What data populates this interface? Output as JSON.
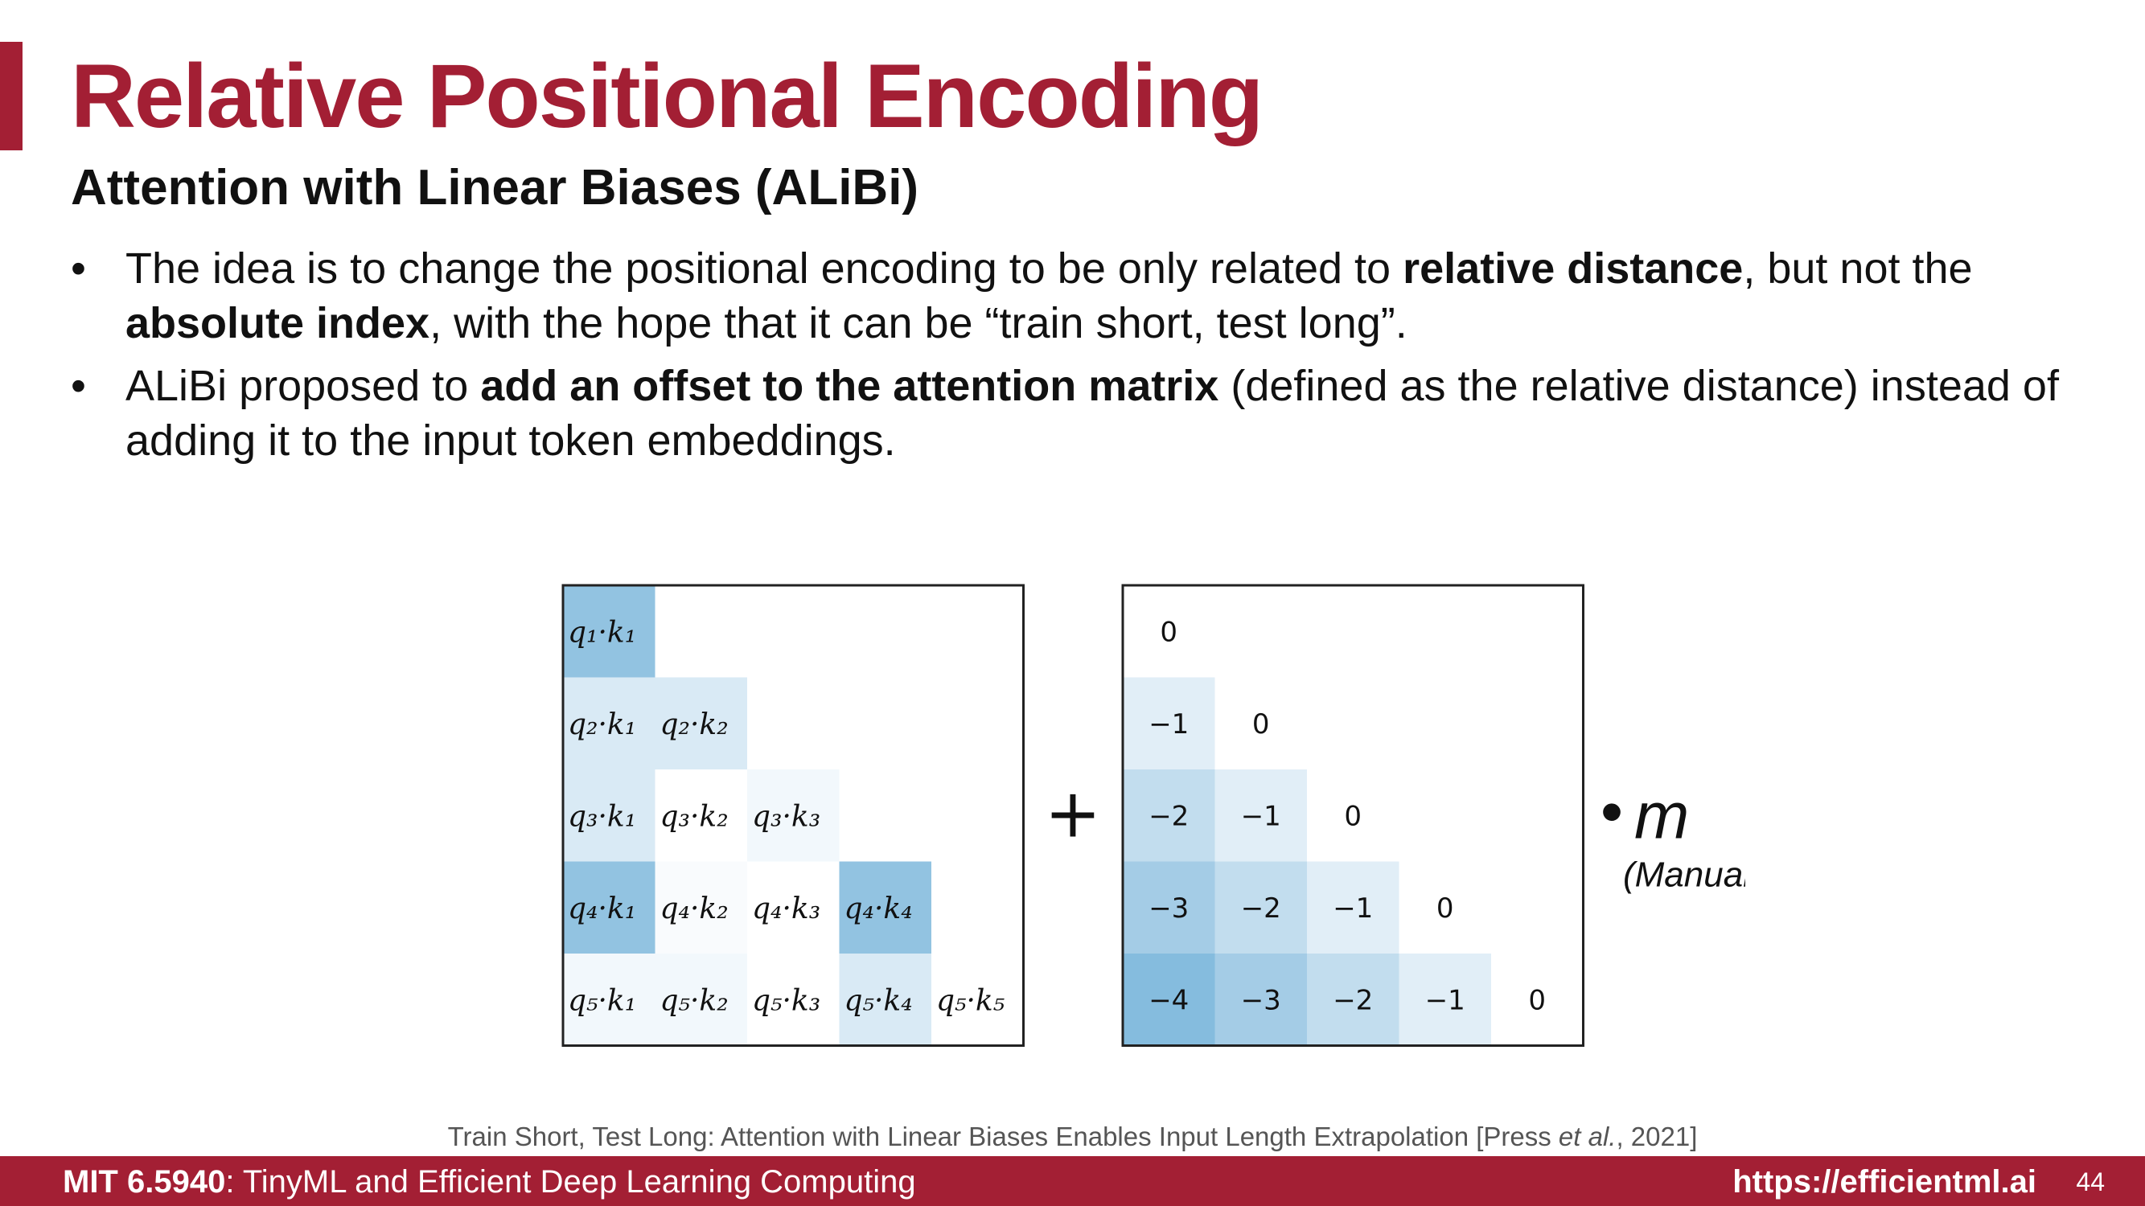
{
  "slide": {
    "title": "Relative Positional Encoding",
    "subtitle": "Attention with Linear Biases (ALiBi)",
    "bullets": [
      {
        "marker": "•",
        "parts": [
          {
            "text": "The idea is to change the positional encoding to be only related to ",
            "bold": false
          },
          {
            "text": "relative distance",
            "bold": true
          },
          {
            "text": ", but not the ",
            "bold": false
          },
          {
            "text": "absolute index",
            "bold": true
          },
          {
            "text": ", with the hope that it can be “train short, test long”.",
            "bold": false
          }
        ]
      },
      {
        "marker": "•",
        "parts": [
          {
            "text": "ALiBi proposed to ",
            "bold": false
          },
          {
            "text": "add an offset to the attention matrix",
            "bold": true
          },
          {
            "text": " (defined as the relative distance) instead of adding it to the input token embeddings.",
            "bold": false
          }
        ]
      }
    ],
    "citation": {
      "before": "Train Short, Test Long: Attention with Linear Biases Enables Input Length Extrapolation [Press ",
      "italic": "et al.",
      "after": ", 2021]"
    },
    "footer": {
      "course_code": "MIT 6.5940",
      "course_name": ": TinyML and Efficient Deep Learning Computing",
      "url": "https://efficientml.ai",
      "page_number": "44"
    }
  },
  "figure": {
    "plus_sign": "+",
    "multiplier_bullet": "•",
    "multiplier_symbol": "m",
    "multiplier_note": "(Manually set)",
    "qk_matrix": {
      "size": 5,
      "shade_levels": [
        [
          0.85
        ],
        [
          0.3,
          0.3
        ],
        [
          0.3,
          0.0,
          0.1
        ],
        [
          0.85,
          0.05,
          0.0,
          0.85
        ],
        [
          0.1,
          0.1,
          0.0,
          0.3,
          0.0
        ]
      ]
    },
    "bias_matrix": {
      "size": 5,
      "rows": [
        [
          "0"
        ],
        [
          "−1",
          "0"
        ],
        [
          "−2",
          "−1",
          "0"
        ],
        [
          "−3",
          "−2",
          "−1",
          "0"
        ],
        [
          "−4",
          "−3",
          "−2",
          "−1",
          "0"
        ]
      ],
      "row_values": [
        [
          0
        ],
        [
          -1,
          0
        ],
        [
          -2,
          -1,
          0
        ],
        [
          -3,
          -2,
          -1,
          0
        ],
        [
          -4,
          -3,
          -2,
          -1,
          0
        ]
      ]
    },
    "colors": {
      "title": "#a31f34",
      "footer_bg": "#a31f34",
      "matrix_high": "#7fb8dc",
      "matrix_low": "#ffffff"
    }
  }
}
